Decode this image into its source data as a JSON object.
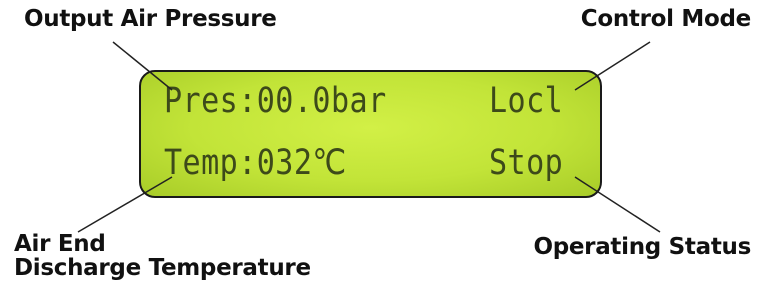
{
  "callouts": {
    "output_air_pressure": "Output Air Pressure",
    "control_mode": "Control Mode",
    "air_end_line1": "Air End",
    "air_end_line2": "Discharge Temperature",
    "operating_status": "Operating Status"
  },
  "lcd": {
    "pressure_readout": "Pres:00.0bar",
    "control_mode_readout": "Locl",
    "temperature_readout": "Temp:032℃",
    "status_readout": "Stop"
  },
  "colors": {
    "lcd_background": "#c2e438",
    "lcd_text": "#3d4a1a",
    "label_text": "#111111",
    "leader_line": "#222222"
  }
}
